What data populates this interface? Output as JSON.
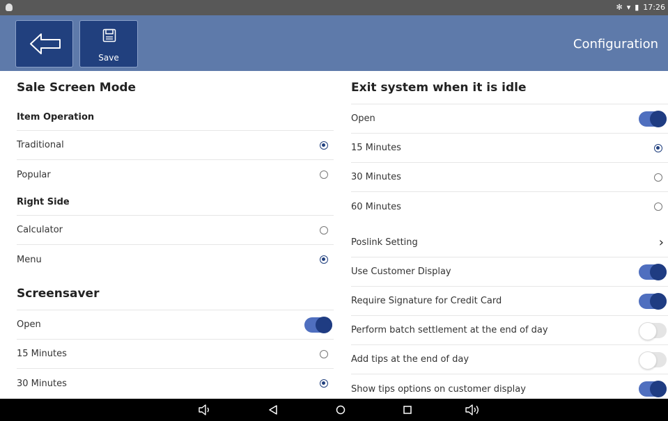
{
  "status_bar": {
    "time": "17:26"
  },
  "header": {
    "title": "Configuration",
    "save_label": "Save"
  },
  "left": {
    "sale_screen": {
      "title": "Sale Screen Mode",
      "item_operation_header": "Item Operation",
      "item_operation_options": [
        {
          "label": "Traditional",
          "selected": true
        },
        {
          "label": "Popular",
          "selected": false
        }
      ],
      "right_side_header": "Right Side",
      "right_side_options": [
        {
          "label": "Calculator",
          "selected": false
        },
        {
          "label": "Menu",
          "selected": true
        }
      ]
    },
    "screensaver": {
      "title": "Screensaver",
      "open_label": "Open",
      "open_on": true,
      "options": [
        {
          "label": "15 Minutes",
          "selected": false
        },
        {
          "label": "30 Minutes",
          "selected": true
        }
      ]
    }
  },
  "right": {
    "idle": {
      "title": "Exit system when it is idle",
      "open_label": "Open",
      "open_on": true,
      "options": [
        {
          "label": "15 Minutes",
          "selected": true
        },
        {
          "label": "30 Minutes",
          "selected": false
        },
        {
          "label": "60 Minutes",
          "selected": false
        }
      ]
    },
    "poslink_label": "Poslink Setting",
    "settings": [
      {
        "label": "Use Customer Display",
        "on": true
      },
      {
        "label": "Require Signature for Credit Card",
        "on": true
      },
      {
        "label": "Perform batch settlement at the end of day",
        "on": false
      },
      {
        "label": "Add tips at the end of day",
        "on": false
      },
      {
        "label": "Show tips options on customer display",
        "on": true
      }
    ]
  },
  "colors": {
    "header_bg": "#5e7aaa",
    "button_bg": "#21407e",
    "toggle_on": "#1f3c82"
  },
  "icons": {
    "back": "back-arrow-icon",
    "save": "floppy-disk-icon",
    "nav": [
      "volume-down-icon",
      "back-triangle-icon",
      "home-circle-icon",
      "recents-square-icon",
      "volume-up-icon"
    ]
  }
}
